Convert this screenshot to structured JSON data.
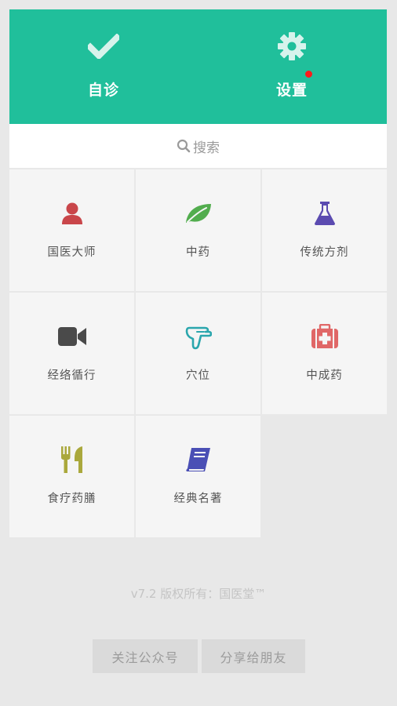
{
  "header": {
    "self_diagnosis_label": "自诊",
    "settings_label": "设置"
  },
  "search": {
    "label": "搜索"
  },
  "grid": {
    "items": [
      {
        "label": "国医大师",
        "icon": "person-icon",
        "color": "#c9464a"
      },
      {
        "label": "中药",
        "icon": "leaf-icon",
        "color": "#52ad4e"
      },
      {
        "label": "传统方剂",
        "icon": "flask-icon",
        "color": "#5b4bb0"
      },
      {
        "label": "经络循行",
        "icon": "video-camera-icon",
        "color": "#4a4a4a"
      },
      {
        "label": "穴位",
        "icon": "pointing-hand-icon",
        "color": "#2aa6ad"
      },
      {
        "label": "中成药",
        "icon": "medkit-icon",
        "color": "#e06767"
      },
      {
        "label": "食疗药膳",
        "icon": "cutlery-icon",
        "color": "#aaa83c"
      },
      {
        "label": "经典名著",
        "icon": "book-icon",
        "color": "#4a4fb5"
      }
    ]
  },
  "footer": {
    "version_text": "v7.2 版权所有：国医堂™",
    "follow_label": "关注公众号",
    "share_label": "分享给朋友"
  },
  "colors": {
    "accent": "#20bf9b",
    "badge": "#ff1a1a"
  }
}
